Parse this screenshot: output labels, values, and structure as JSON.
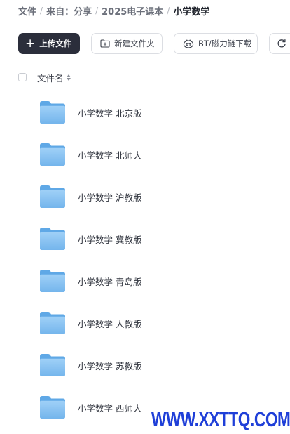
{
  "breadcrumb": {
    "items": [
      "文件",
      "来自：分享",
      "2025电子课本",
      "小学数学"
    ],
    "separator": "/"
  },
  "toolbar": {
    "upload_label": "上传文件",
    "new_folder_label": "新建文件夹",
    "bt_download_label": "BT/磁力链下载"
  },
  "list": {
    "column_name": "文件名",
    "items": [
      {
        "name": "小学数学 北京版",
        "type": "folder"
      },
      {
        "name": "小学数学 北师大",
        "type": "folder"
      },
      {
        "name": "小学数学 沪教版",
        "type": "folder"
      },
      {
        "name": "小学数学 冀教版",
        "type": "folder"
      },
      {
        "name": "小学数学 青岛版",
        "type": "folder"
      },
      {
        "name": "小学数学 人教版",
        "type": "folder"
      },
      {
        "name": "小学数学 苏教版",
        "type": "folder"
      },
      {
        "name": "小学数学 西师大",
        "type": "folder"
      }
    ]
  },
  "watermark": "WWW.XXTTQ.COM",
  "colors": {
    "primary_button": "#2b2e3b",
    "folder_blue": "#7fbdf0",
    "watermark": "#1f3fd8"
  },
  "icons": [
    "plus-icon",
    "new-folder-icon",
    "bt-icon",
    "refresh-icon",
    "sort-icon",
    "folder-icon"
  ]
}
